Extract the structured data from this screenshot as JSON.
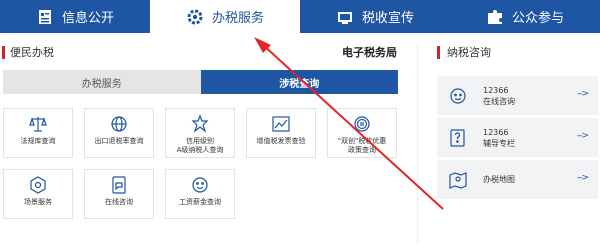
{
  "nav": {
    "tabs": [
      {
        "label": "信息公开",
        "icon": "document-icon"
      },
      {
        "label": "办税服务",
        "icon": "gear-icon"
      },
      {
        "label": "税收宣传",
        "icon": "tv-icon"
      },
      {
        "label": "公众参与",
        "icon": "puzzle-icon"
      }
    ],
    "active_index": 1
  },
  "main": {
    "section_title": "便民办税",
    "etax_link": "电子税务局",
    "subtabs": [
      {
        "label": "办税服务",
        "active": false
      },
      {
        "label": "涉税查询",
        "active": true
      }
    ],
    "services": [
      {
        "label": "法规库查询",
        "icon": "scales-icon"
      },
      {
        "label": "出口退税率查询",
        "icon": "globe-icon"
      },
      {
        "label": "信用级别\nA级纳税人查询",
        "icon": "star-shield-icon"
      },
      {
        "label": "增值税发票查验",
        "icon": "chart-icon"
      },
      {
        "label": "\"双创\"税收优惠\n政策查询",
        "icon": "badge-icon"
      },
      {
        "label": "场景服务",
        "icon": "hexagon-icon"
      },
      {
        "label": "在线咨询",
        "icon": "chat-icon"
      },
      {
        "label": "工资薪金查询",
        "icon": "smile-icon"
      }
    ]
  },
  "side": {
    "section_title": "纳税咨询",
    "items": [
      {
        "line1": "12366",
        "line2": "在线咨询",
        "icon": "headset-icon"
      },
      {
        "line1": "12366",
        "line2": "辅导专栏",
        "icon": "question-icon"
      },
      {
        "line1": "办税地图",
        "line2": "",
        "icon": "map-icon"
      }
    ],
    "arrow": "-->"
  },
  "colors": {
    "primary": "#1f56a3",
    "accent_red": "#c8272f",
    "annotation_arrow": "#e3262a"
  }
}
